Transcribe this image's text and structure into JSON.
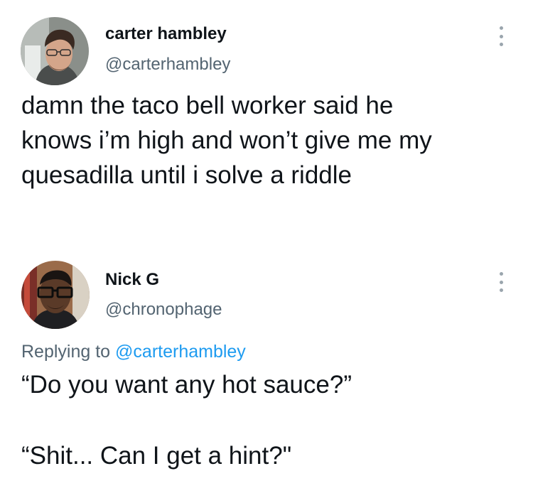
{
  "tweets": [
    {
      "display_name": "carter hambley",
      "handle": "@carterhambley",
      "text": "damn the taco bell worker said he\nknows i’m high and won’t give me my\nquesadilla until i solve a riddle",
      "avatar_icon": "user-photo-icon",
      "more_icon": "more-options-icon"
    },
    {
      "display_name": "Nick G",
      "handle": "@chronophage",
      "replying_prefix": "Replying to ",
      "replying_to": "@carterhambley",
      "text": "“Do you want any hot sauce?”\n\n“Shit... Can I get a hint?\"",
      "avatar_icon": "user-photo-icon",
      "more_icon": "more-options-icon"
    }
  ],
  "colors": {
    "text": "#0f1419",
    "secondary": "#536471",
    "link": "#1d9bf0"
  }
}
